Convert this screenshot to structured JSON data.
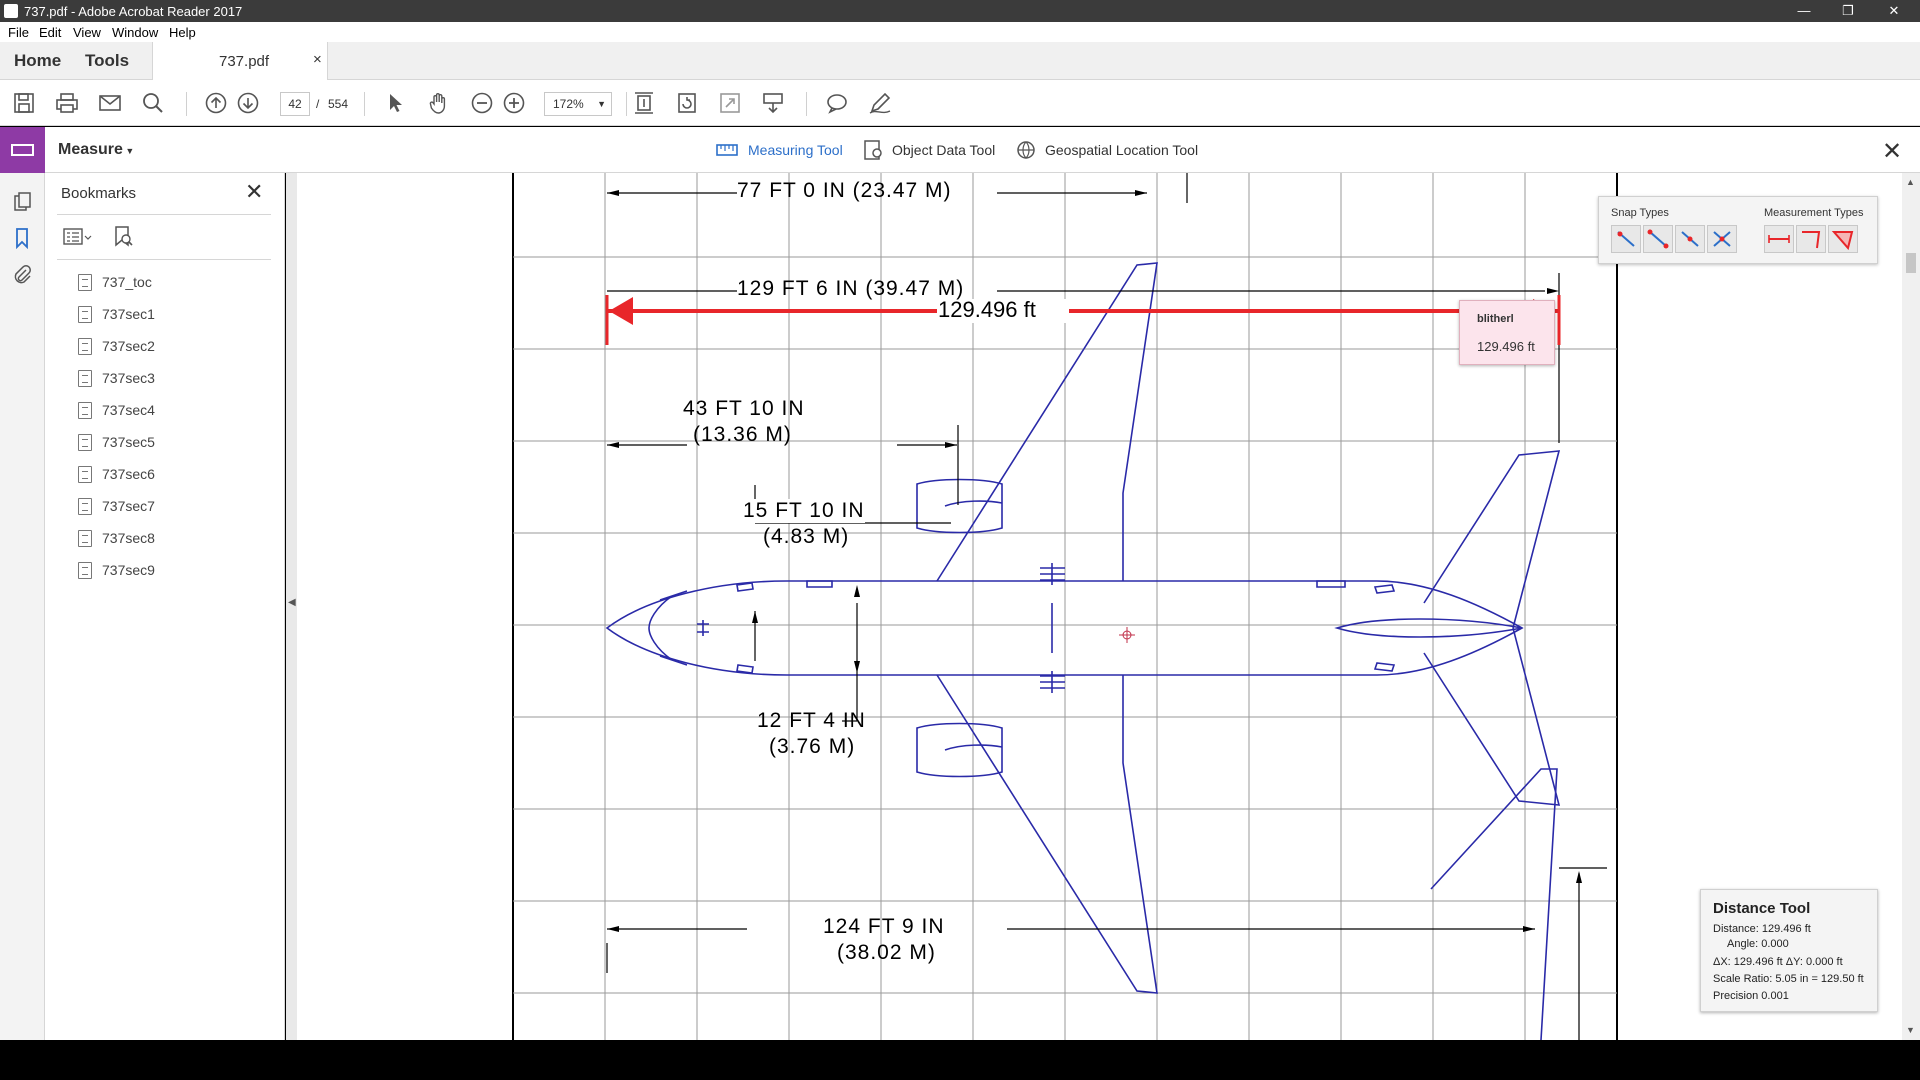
{
  "window": {
    "title": "737.pdf - Adobe Acrobat Reader 2017",
    "controls": [
      "—",
      "❐",
      "✕"
    ]
  },
  "menu": [
    "File",
    "Edit",
    "View",
    "Window",
    "Help"
  ],
  "tabs": {
    "home": "Home",
    "tools": "Tools",
    "document": "737.pdf",
    "close": "×"
  },
  "toolbar": {
    "page_current": "42",
    "page_sep": "/",
    "page_total": "554",
    "zoom": "172%"
  },
  "measure_bar": {
    "label": "Measure",
    "tools": [
      {
        "label": "Measuring Tool",
        "active": true
      },
      {
        "label": "Object Data Tool",
        "active": false
      },
      {
        "label": "Geospatial Location Tool",
        "active": false
      }
    ]
  },
  "bookmarks": {
    "title": "Bookmarks",
    "items": [
      "737_toc",
      "737sec1",
      "737sec2",
      "737sec3",
      "737sec4",
      "737sec5",
      "737sec6",
      "737sec7",
      "737sec8",
      "737sec9"
    ]
  },
  "drawing": {
    "dim_top": "77 FT 0 IN (23.47 M)",
    "dim_span": "129 FT 6 IN (39.47 M)",
    "measure_label": "129.496 ft",
    "dim_engine_1": "43 FT 10 IN",
    "dim_engine_2": "(13.36 M)",
    "dim_tread_1": "15 FT 10 IN",
    "dim_tread_2": "(4.83 M)",
    "dim_fuse_1": "12 FT 4 IN",
    "dim_fuse_2": "(3.76 M)",
    "dim_bottom_1": "124 FT 9 IN",
    "dim_bottom_2": "(38.02 M)",
    "measure_color": "#e8262a",
    "aircraft_color": "#2a2aa8"
  },
  "snap_panel": {
    "snap_label": "Snap Types",
    "measurement_label": "Measurement Types"
  },
  "note_popup": {
    "author": "blitherl",
    "value": "129.496 ft"
  },
  "distance_panel": {
    "title": "Distance Tool",
    "distance": "Distance:  129.496 ft",
    "angle": "Angle:  0.000",
    "delta": "ΔX:  129.496 ft     ΔY:  0.000 ft",
    "scale": "Scale Ratio:  5.05 in = 129.50 ft",
    "precision": "Precision      0.001"
  }
}
